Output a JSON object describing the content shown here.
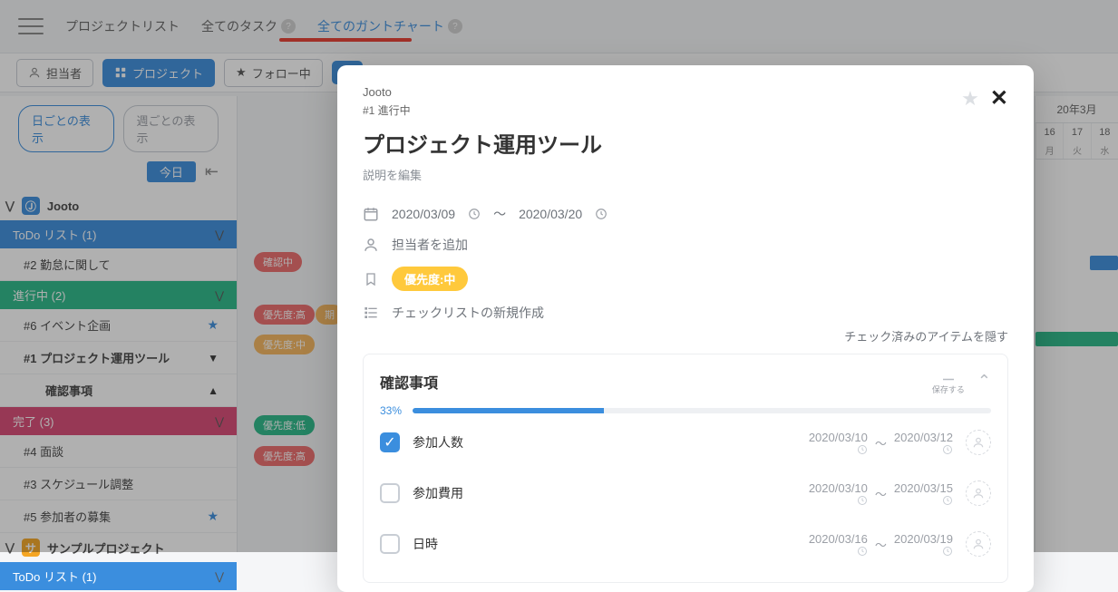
{
  "nav": {
    "project_list": "プロジェクトリスト",
    "all_tasks": "全てのタスク",
    "all_gantt": "全てのガントチャート"
  },
  "toolbar": {
    "assignee": "担当者",
    "project": "プロジェクト",
    "following": "フォロー中"
  },
  "sidebar": {
    "view_day": "日ごとの表示",
    "view_week": "週ごとの表示",
    "today": "今日",
    "projects": [
      {
        "name": "Jooto",
        "color": "#3b8ede"
      },
      {
        "name": "サンプルプロジェクト",
        "color": "#f5a623"
      }
    ],
    "lists": {
      "todo": "ToDo リスト (1)",
      "progress": "進行中 (2)",
      "done": "完了 (3)",
      "todo2": "ToDo リスト (1)"
    },
    "tasks": {
      "t2": "#2 勤怠に関して",
      "t6": "#6 イベント企画",
      "t1": "#1 プロジェクト運用ツール",
      "t1sub": "確認事項",
      "t4": "#4 面談",
      "t3": "#3 スケジュール調整",
      "t5": "#5 参加者の募集"
    }
  },
  "chips": {
    "confirm": "確認中",
    "prio_high": "優先度:高",
    "prio_mid": "優先度:中",
    "prio_low": "優先度:低",
    "deadline": "期"
  },
  "gantt": {
    "month": "20年3月",
    "days": [
      "16",
      "17",
      "18"
    ],
    "wd": [
      "月",
      "火",
      "水"
    ]
  },
  "modal": {
    "breadcrumb": "Jooto",
    "status": "#1 進行中",
    "title": "プロジェクト運用ツール",
    "edit_desc": "説明を編集",
    "date_start": "2020/03/09",
    "date_end": "2020/03/20",
    "date_sep": "～",
    "add_assignee": "担当者を追加",
    "priority": "優先度:中",
    "new_checklist": "チェックリストの新規作成",
    "hide_done": "チェック済みのアイテムを隠す",
    "checklist": {
      "title": "確認事項",
      "percent": "33%",
      "percent_val": 33,
      "save": "保存する",
      "items": [
        {
          "label": "参加人数",
          "done": true,
          "start": "2020/03/10",
          "end": "2020/03/12"
        },
        {
          "label": "参加費用",
          "done": false,
          "start": "2020/03/10",
          "end": "2020/03/15"
        },
        {
          "label": "日時",
          "done": false,
          "start": "2020/03/16",
          "end": "2020/03/19"
        }
      ]
    }
  }
}
